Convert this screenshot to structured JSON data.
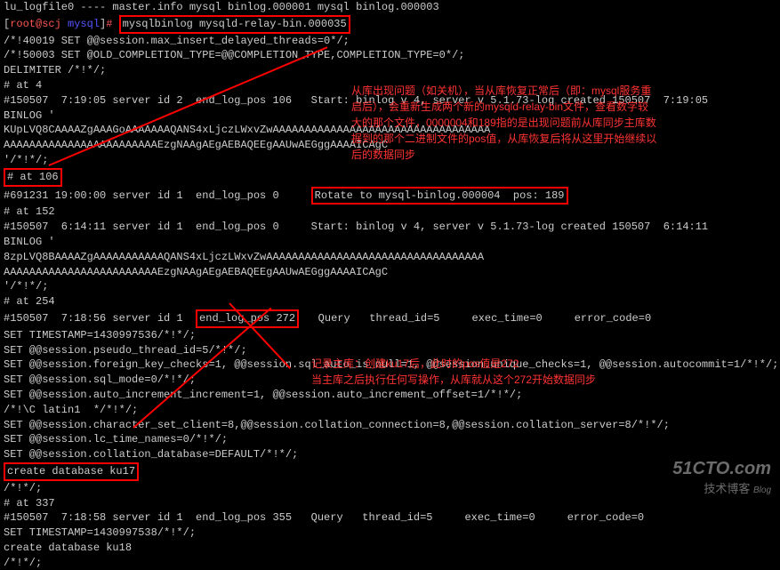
{
  "topline": "lu_logfile0 ---- master.info mysql binlog.000001 mysql binlog.000003",
  "prompt": {
    "user": "root@scj",
    "path": "mysql",
    "cmd": "mysqlbinlog mysqld-relay-bin.000035"
  },
  "lines": {
    "l1": "/*!40019 SET @@session.max_insert_delayed_threads=0*/;",
    "l2": "/*!50003 SET @OLD_COMPLETION_TYPE=@@COMPLETION_TYPE,COMPLETION_TYPE=0*/;",
    "l3": "DELIMITER /*!*/;",
    "l4": "# at 4",
    "l5": "#150507  7:19:05 server id 2  end_log_pos 106   Start: binlog v 4, server v 5.1.73-log created 150507  7:19:05",
    "l6": "BINLOG '",
    "l7": "KUpLVQ8CAAAAZgAAAGoAAAAAAAQANS4xLjczLWxvZwAAAAAAAAAAAAAAAAAAAAAAAAAAAAAAAAAA",
    "l8": "AAAAAAAAAAAAAAAAAAAAAAAAEzgNAAgAEgAEBAQEEgAAUwAEGggAAAAICAgC",
    "l9": "'/*!*/;",
    "at106": "# at 106",
    "l10a": "#691231 19:00:00 server id 1  end_log_pos 0     ",
    "l10b": "Rotate to mysql-binlog.000004  pos: 189",
    "l11": "# at 152",
    "l12": "#150507  6:14:11 server id 1  end_log_pos 0     Start: binlog v 4, server v 5.1.73-log created 150507  6:14:11",
    "l13": "BINLOG '",
    "l14": "8zpLVQ8BAAAAZgAAAAAAAAAAAQANS4xLjczLWxvZwAAAAAAAAAAAAAAAAAAAAAAAAAAAAAAAAAA",
    "l15": "AAAAAAAAAAAAAAAAAAAAAAAAEzgNAAgAEgAEBAQEEgAAUwAEGggAAAAICAgC",
    "l16": "'/*!*/;",
    "l17": "# at 254",
    "l18a": "#150507  7:18:56 server id 1  ",
    "l18b": "end_log_pos 272",
    "l18c": "   Query   thread_id=5     exec_time=0     error_code=0",
    "l19": "SET TIMESTAMP=1430997536/*!*/;",
    "l20": "SET @@session.pseudo_thread_id=5/*!*/;",
    "l21": "SET @@session.foreign_key_checks=1, @@session.sql_auto_is_null=1, @@session.unique_checks=1, @@session.autocommit=1/*!*/;",
    "l22": "SET @@session.sql_mode=0/*!*/;",
    "l23": "SET @@session.auto_increment_increment=1, @@session.auto_increment_offset=1/*!*/;",
    "l24": "/*!\\C latin1  */*!*/;",
    "l25": "SET @@session.character_set_client=8,@@session.collation_connection=8,@@session.collation_server=8/*!*/;",
    "l26": "SET @@session.lc_time_names=0/*!*/;",
    "l27": "SET @@session.collation_database=DEFAULT/*!*/;",
    "createku17": "create database ku17",
    "l28": "/*!*/;",
    "l29": "# at 337",
    "l30": "#150507  7:18:58 server id 1  end_log_pos 355   Query   thread_id=5     exec_time=0     error_code=0",
    "l31": "SET TIMESTAMP=1430997538/*!*/;",
    "l32": "create database ku18",
    "l33": "/*!*/;"
  },
  "annotations": {
    "a1_l1": "从库出现问题（如关机），当从库恢复正常后（即：mysql服务重",
    "a1_l2": "启后），会重新生成两个新的mysqld-relay-bin文件，查看数字较",
    "a1_l3": "大的那个文件，0000004和189指的是出现问题前从库同步主库数",
    "a1_l4": "据到的那个二进制文件的pos值，从库恢复后将从这里开始继续以",
    "a1_l5": "后的数据同步",
    "a2_l1": "记录主库：创建ku17后，此时的pos值是272",
    "a2_l2": "当主库之后执行任何写操作，从库就从这个272开始数据同步"
  },
  "watermark": {
    "main": "51CTO.com",
    "sub": "技术博客",
    "blog": "Blog"
  }
}
